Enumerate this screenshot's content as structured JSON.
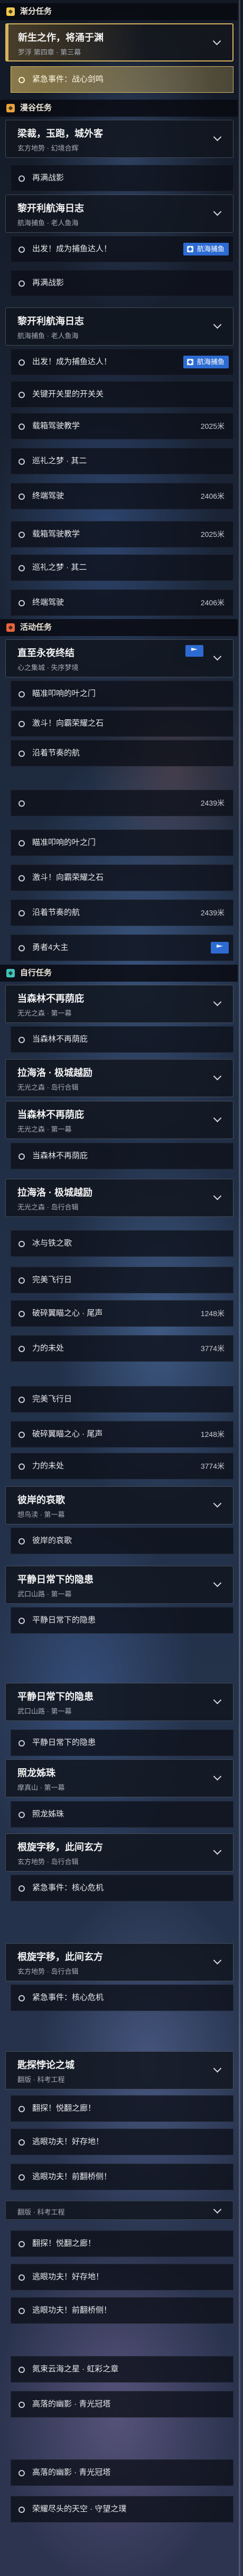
{
  "colors": {
    "tracked_border": "#d6b25e",
    "selected_fill": "#d9b861",
    "tag_fill": "#2d6bd2",
    "title_text": "#f2f2f2",
    "subtitle_text": "#a6abb6"
  },
  "quest_list": {
    "rows": [
      {
        "type": "header",
        "label": "渐分任务",
        "icon": "quest-category-icon",
        "color": "#f2c94c"
      },
      {
        "type": "card",
        "title": "新生之作，将涌于渊",
        "subtitle": "罗浮 第四章 · 第三幕",
        "tracked": true
      },
      {
        "type": "task",
        "label": "紧急事件：战心剑鸣",
        "selected": true
      },
      {
        "type": "header",
        "label": "漫谷任务",
        "icon": "quest-category-icon",
        "color": "#e9a23b"
      },
      {
        "type": "card",
        "title": "梁裁，玉跑，城外客",
        "subtitle": "玄方地势 · 幻境合辉"
      },
      {
        "type": "task",
        "label": "再满战影"
      },
      {
        "type": "card",
        "title": "黎开利航海日志",
        "subtitle": "航海捕鱼 · 老人鱼海"
      },
      {
        "type": "task",
        "label": "出发！成为捕鱼达人！",
        "tag": "航海捕鱼"
      },
      {
        "type": "task",
        "label": "再满战影"
      },
      {
        "type": "card",
        "title": "黎开利航海日志",
        "subtitle": "航海捕鱼 · 老人鱼海"
      },
      {
        "type": "task",
        "label": "出发！成为捕鱼达人！",
        "tag": "航海捕鱼"
      },
      {
        "type": "task",
        "label": "关键开关里的开关关"
      },
      {
        "type": "task",
        "label": "载箱驾驶教学",
        "distance": "2025米"
      },
      {
        "type": "task",
        "label": "巡礼之梦 · 其二"
      },
      {
        "type": "task",
        "label": "终端驾驶",
        "distance": "2406米"
      },
      {
        "type": "task",
        "label": "载箱驾驶教学",
        "distance": "2025米"
      },
      {
        "type": "task",
        "label": "巡礼之梦 · 其二"
      },
      {
        "type": "task",
        "label": "终端驾驶",
        "distance": "2406米"
      },
      {
        "type": "header",
        "label": "活动任务",
        "icon": "quest-category-icon",
        "color": "#e8643a"
      },
      {
        "type": "card",
        "title": "直至永夜终结",
        "subtitle": "心之集城 · 失序梦境",
        "badge": true
      },
      {
        "type": "task",
        "label": "瞄准叩响的叶之门"
      },
      {
        "type": "task",
        "label": "激斗！向霸荣耀之石"
      },
      {
        "type": "task",
        "label": "沿着节奏的航"
      },
      {
        "type": "task",
        "label": "",
        "distance": "2439米"
      },
      {
        "type": "task",
        "label": "瞄准叩响的叶之门"
      },
      {
        "type": "task",
        "label": "激斗！向霸荣耀之石"
      },
      {
        "type": "task",
        "label": "沿着节奏的航",
        "distance": "2439米"
      },
      {
        "type": "task",
        "label": "勇者4大主",
        "badge": true
      },
      {
        "type": "header",
        "label": "自行任务",
        "icon": "quest-category-icon",
        "color": "#3fc4b8"
      },
      {
        "type": "card",
        "title": "当森林不再荫庇",
        "subtitle": "无光之森 · 第一幕"
      },
      {
        "type": "task",
        "label": "当森林不再荫庇"
      },
      {
        "type": "card",
        "title": "拉海洛 · 极城越励",
        "subtitle": "无光之森 · 岛行合辑"
      },
      {
        "type": "card",
        "title": "当森林不再荫庇",
        "subtitle": "无光之森 · 第一幕"
      },
      {
        "type": "task",
        "label": "当森林不再荫庇"
      },
      {
        "type": "card",
        "title": "拉海洛 · 极城越励",
        "subtitle": "无光之森 · 岛行合辑"
      },
      {
        "type": "task",
        "label": "冰与铁之歌"
      },
      {
        "type": "task",
        "label": "完美飞行日"
      },
      {
        "type": "task",
        "label": "破碎翼瞄之心 · 尾声",
        "distance": "1248米"
      },
      {
        "type": "task",
        "label": "力的未处",
        "distance": "3774米"
      },
      {
        "type": "task",
        "label": "完美飞行日"
      },
      {
        "type": "task",
        "label": "破碎翼瞄之心 · 尾声",
        "distance": "1248米"
      },
      {
        "type": "task",
        "label": "力的未处",
        "distance": "3774米"
      },
      {
        "type": "card",
        "title": "彼岸的哀歌",
        "subtitle": "想鸟渎 · 第一幕"
      },
      {
        "type": "task",
        "label": "彼岸的哀歌"
      },
      {
        "type": "card",
        "title": "平静日常下的隐患",
        "subtitle": "武口山路 · 第一幕"
      },
      {
        "type": "task",
        "label": "平静日常下的隐患"
      },
      {
        "type": "card",
        "title": "平静日常下的隐患",
        "subtitle": "武口山路 · 第一幕"
      },
      {
        "type": "task",
        "label": "平静日常下的隐患"
      },
      {
        "type": "card",
        "title": "照龙姊珠",
        "subtitle": "摩真山 · 第一幕"
      },
      {
        "type": "task",
        "label": "照龙姊珠"
      },
      {
        "type": "card",
        "title": "根旋字移，此间玄方",
        "subtitle": "玄方地势 · 岛行合辑"
      },
      {
        "type": "task",
        "label": "紧急事件：核心危机"
      },
      {
        "type": "card",
        "title": "根旋字移，此间玄方",
        "subtitle": "玄方地势 · 岛行合辑"
      },
      {
        "type": "task",
        "label": "紧急事件：核心危机"
      },
      {
        "type": "card",
        "title": "匙探悖论之城",
        "subtitle": "翻版 · 科考工程"
      },
      {
        "type": "task",
        "label": "翻探！悦翻之廊！"
      },
      {
        "type": "task",
        "label": "逃眼功夫！好存地！"
      },
      {
        "type": "task",
        "label": "逃眼功夫！前翻桥侧！"
      },
      {
        "type": "subtitle",
        "subtitle": "翻版 · 科考工程"
      },
      {
        "type": "task",
        "label": "翻探！悦翻之廊！"
      },
      {
        "type": "task",
        "label": "逃眼功夫！好存地！"
      },
      {
        "type": "task",
        "label": "逃眼功夫！前翻桥侧！"
      },
      {
        "type": "task",
        "label": "氮束云海之星 · 虹彩之章"
      },
      {
        "type": "task",
        "label": "高落的幽影 · 青光冠塔"
      },
      {
        "type": "task",
        "label": "高落的幽影 · 青光冠塔"
      },
      {
        "type": "task",
        "label": "荣耀尽头的天空 · 守望之璞"
      }
    ]
  }
}
